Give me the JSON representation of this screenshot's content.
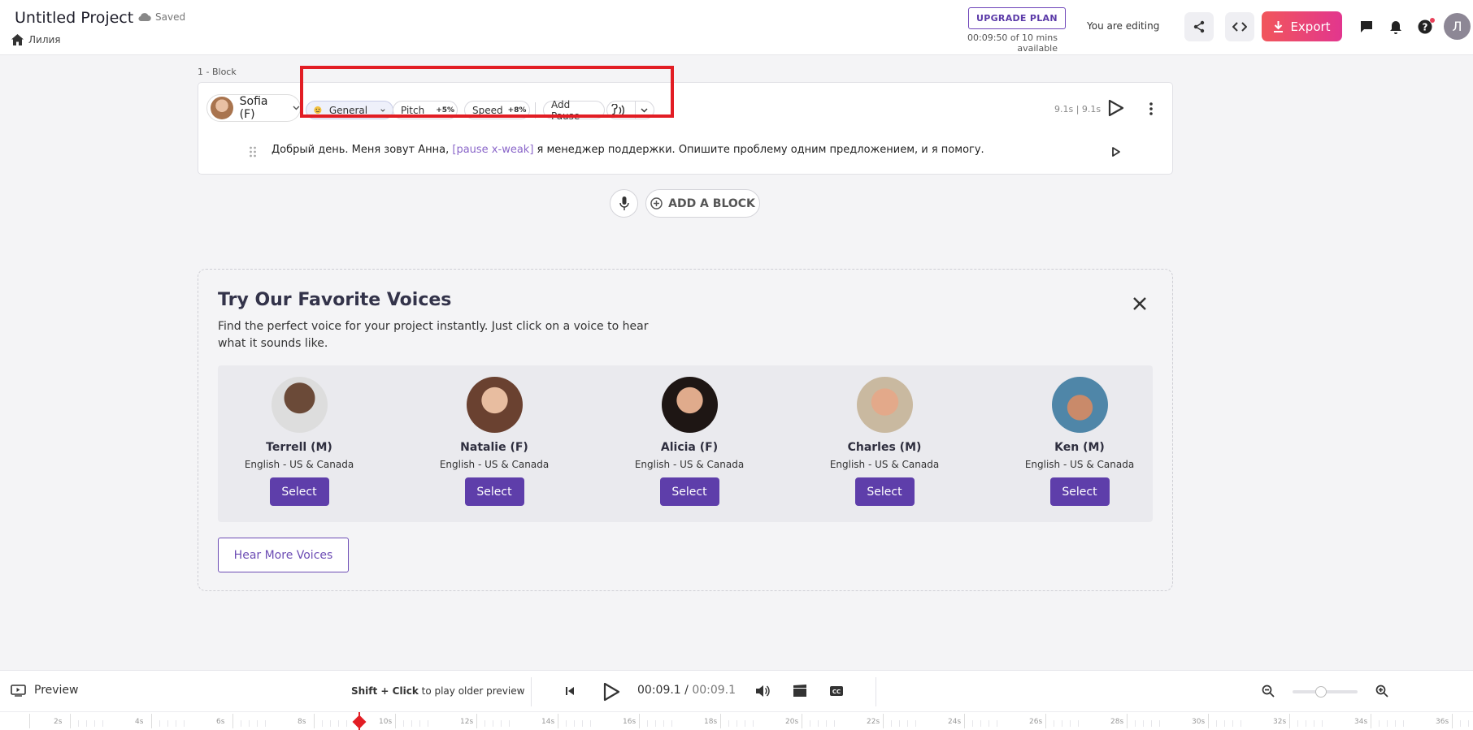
{
  "header": {
    "project_title": "Untitled Project",
    "saved_label": "Saved",
    "breadcrumb_home": "Лилия",
    "upgrade_label": "UPGRADE PLAN",
    "minutes_available": "00:09:50 of 10 mins available",
    "editing_label": "You are editing",
    "export_label": "Export",
    "avatar_initial": "Л"
  },
  "block": {
    "label": "1 -   Block",
    "voice_name": "Sofia (F)",
    "style_label": "General",
    "pitch_label": "Pitch",
    "pitch_value": "+5%",
    "speed_label": "Speed",
    "speed_value": "+8%",
    "add_pause_label": "Add Pause",
    "duration": "9.1s | 9.1s",
    "text_before": "Добрый день. Меня зовут Анна,",
    "pause_tag": "[pause x-weak]",
    "text_after": "я менеджер поддержки. Опишите проблему одним предложением, и я помогу."
  },
  "add_block_label": "ADD A BLOCK",
  "favorites": {
    "title": "Try Our Favorite Voices",
    "subtitle": "Find the perfect voice for your project instantly. Just click on a voice to hear what it sounds like.",
    "voices": [
      {
        "name": "Terrell (M)",
        "lang": "English - US & Canada",
        "select": "Select"
      },
      {
        "name": "Natalie (F)",
        "lang": "English - US & Canada",
        "select": "Select"
      },
      {
        "name": "Alicia (F)",
        "lang": "English - US & Canada",
        "select": "Select"
      },
      {
        "name": "Charles (M)",
        "lang": "English - US & Canada",
        "select": "Select"
      },
      {
        "name": "Ken (M)",
        "lang": "English - US & Canada",
        "select": "Select"
      }
    ],
    "hear_more_label": "Hear More Voices"
  },
  "bottom": {
    "preview_label": "Preview",
    "shift_bold": "Shift + Click",
    "shift_rest": " to play older preview",
    "time_current": "00:09.1",
    "time_total": "00:09.1",
    "ruler_labels": [
      "2s",
      "4s",
      "6s",
      "8s",
      "10s",
      "12s",
      "14s",
      "16s",
      "18s",
      "20s",
      "22s",
      "24s",
      "26s",
      "28s",
      "30s",
      "32s",
      "34s",
      "36s"
    ]
  },
  "colors": {
    "accent_purple": "#5e3eaa",
    "export_gradient_start": "#f1565b",
    "export_gradient_end": "#e2368e",
    "highlight_red": "#e21d24"
  }
}
